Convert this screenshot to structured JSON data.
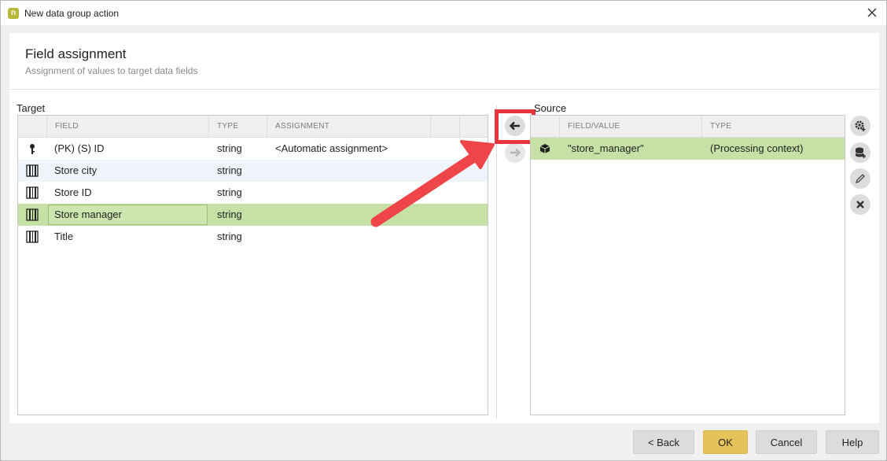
{
  "window": {
    "title": "New data group action"
  },
  "header": {
    "title": "Field assignment",
    "subtitle": "Assignment of values to target data fields"
  },
  "target": {
    "label": "Target",
    "columns": [
      "FIELD",
      "TYPE",
      "ASSIGNMENT"
    ],
    "rows": [
      {
        "icon": "key-icon",
        "field": "(PK) (S) ID",
        "type": "string",
        "assignment": "<Automatic assignment>"
      },
      {
        "icon": "barcode-field-icon",
        "field": "Store city",
        "type": "string",
        "assignment": ""
      },
      {
        "icon": "barcode-field-icon",
        "field": "Store ID",
        "type": "string",
        "assignment": ""
      },
      {
        "icon": "barcode-field-icon",
        "field": "Store manager",
        "type": "string",
        "assignment": ""
      },
      {
        "icon": "barcode-field-icon",
        "field": "Title",
        "type": "string",
        "assignment": ""
      }
    ],
    "selected_row": "Store manager"
  },
  "source": {
    "label": "Source",
    "columns": [
      "FIELD/VALUE",
      "TYPE"
    ],
    "rows": [
      {
        "icon": "cube-icon",
        "value": "\"store_manager\"",
        "type": "(Processing context)"
      }
    ]
  },
  "transfer_buttons": [
    {
      "name": "assign-left",
      "icon": "arrow-left-icon",
      "enabled": true
    },
    {
      "name": "assign-right",
      "icon": "arrow-right-icon",
      "enabled": false
    }
  ],
  "side_tools": [
    "gear-add-icon",
    "database-add-icon",
    "pencil-icon",
    "delete-icon"
  ],
  "footer": {
    "back": "< Back",
    "ok": "OK",
    "cancel": "Cancel",
    "help": "Help"
  },
  "colors": {
    "selection": "#c5e1a5",
    "ok_button": "#e6c35a",
    "annotation": "#e8343c"
  }
}
